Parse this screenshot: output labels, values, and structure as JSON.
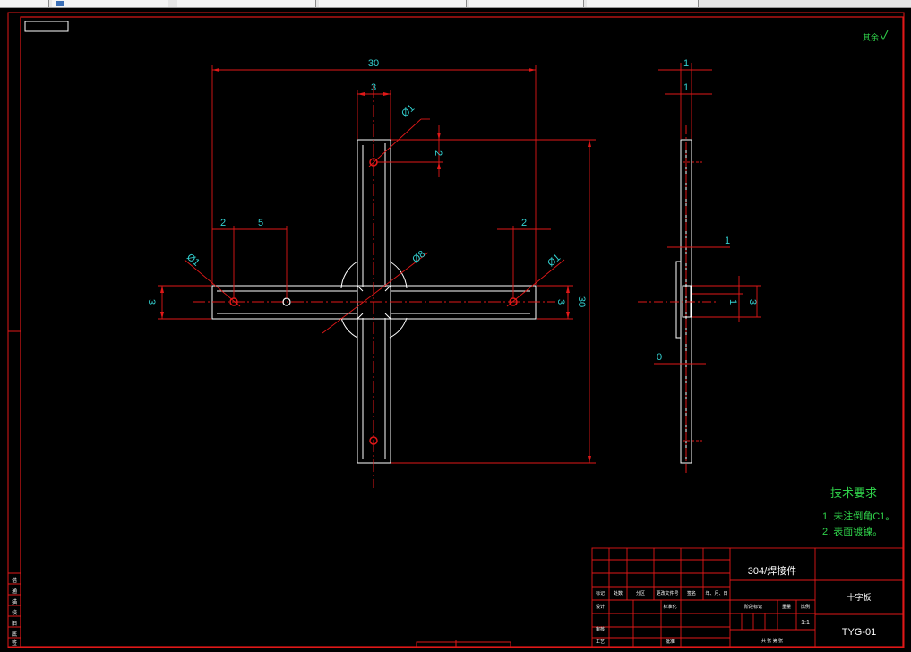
{
  "tabs": [
    {
      "label": ""
    },
    {
      "label": ""
    },
    {
      "label": ""
    },
    {
      "label": ""
    },
    {
      "label": ""
    },
    {
      "label": ""
    }
  ],
  "drawing": {
    "corner_mark": "其余",
    "dimensions": {
      "overall_width": "30",
      "arm_width_top": "3",
      "hole_top": "Ø1",
      "offset_top": "2",
      "left_2": "2",
      "left_5": "5",
      "right_2": "2",
      "hole_left": "Ø1",
      "hole_right": "Ø1",
      "center_dia": "Ø8",
      "height_left": "3",
      "height_right": "3",
      "overall_height": "30",
      "side_1a": "1",
      "side_1b": "1",
      "side_1c": "1",
      "side_1d": "1",
      "side_3": "3",
      "side_0": "0"
    },
    "tech_req": {
      "title": "技术要求",
      "line1": "1. 未注倒角C1。",
      "line2": "2. 表面镀镍。"
    },
    "title_block": {
      "material": "304/焊接件",
      "part_name": "十字板",
      "drawing_no": "TYG-01",
      "scale": "1:1",
      "row_labels": [
        "标记",
        "处数",
        "分区",
        "更改文件号",
        "签名",
        "年、月、日"
      ],
      "design": "设计",
      "standard": "标准化",
      "check": "审核",
      "process": "工艺",
      "approve": "批准",
      "stage": "阶段标记",
      "weight": "重量",
      "ratio": "比例",
      "sheets": "共 张 第 张"
    },
    "left_margin_labels": [
      "借",
      "通",
      "描",
      "校",
      "旧",
      "底",
      "签"
    ]
  }
}
